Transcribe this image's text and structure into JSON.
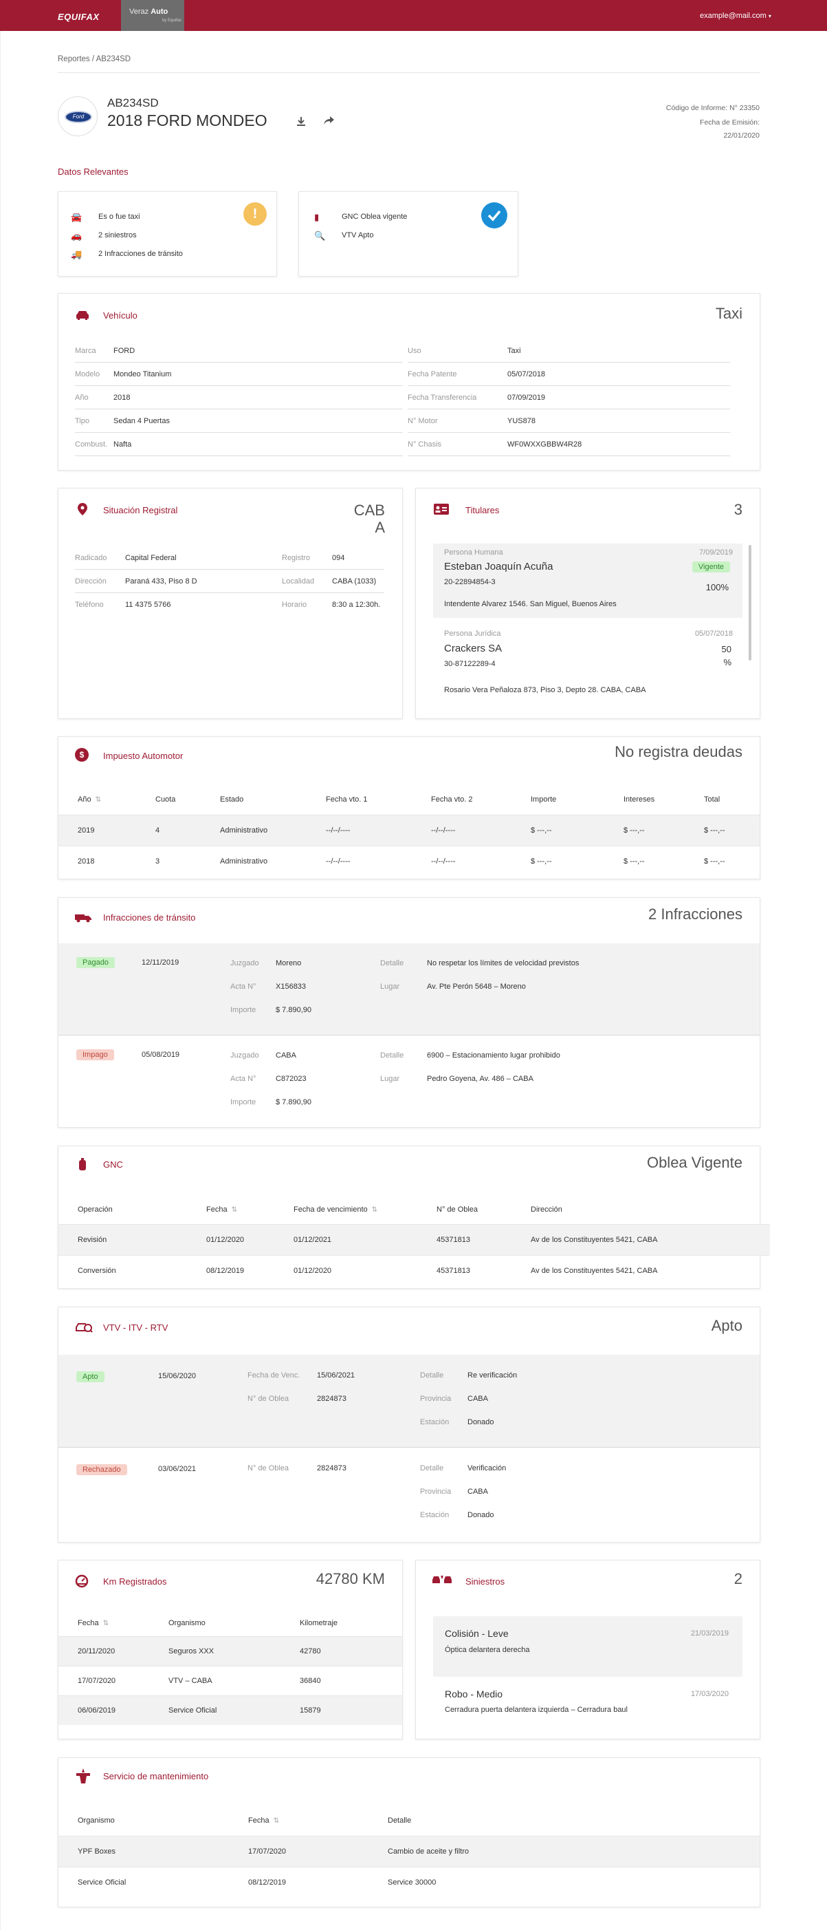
{
  "header": {
    "logo": "EQUIFAX",
    "app_name_1": "Veraz",
    "app_name_2": "Auto",
    "app_sub": "by Equifax",
    "user_email": "example@mail.com"
  },
  "breadcrumb": "Reportes / AB234SD",
  "vehicle_head": {
    "plate": "AB234SD",
    "title": "2018 FORD MONDEO",
    "brand_logo": "Ford",
    "code": "Código de Informe: N° 23350",
    "emission_label": "Fecha de Emisión:",
    "emission_date": "22/01/2020"
  },
  "relevant": {
    "title": "Datos Relevantes",
    "left": [
      "Es o fue taxi",
      "2 siniestros",
      "2 Infracciones de tránsito"
    ],
    "right": [
      "GNC Oblea vigente",
      "VTV Apto"
    ],
    "warning_icon": "exclamation-icon",
    "ok_icon": "check-icon"
  },
  "vehiculo": {
    "title": "Vehículo",
    "status": "Taxi",
    "left": [
      [
        "Marca",
        "FORD"
      ],
      [
        "Modelo",
        "Mondeo Titanium"
      ],
      [
        "Año",
        "2018"
      ],
      [
        "Tipo",
        "Sedan 4 Puertas"
      ],
      [
        "Combust.",
        "Nafta"
      ]
    ],
    "right": [
      [
        "Uso",
        "Taxi"
      ],
      [
        "Fecha Patente",
        "05/07/2018"
      ],
      [
        "Fecha Transferencia",
        "07/09/2019"
      ],
      [
        "N° Motor",
        "YUS878"
      ],
      [
        "N° Chasis",
        "WF0WXXGBBW4R28"
      ]
    ]
  },
  "registral": {
    "title": "Situación Registral",
    "status_1": "CAB",
    "status_2": "A",
    "rows": [
      [
        "Radicado",
        "Capital Federal",
        "Registro",
        "094"
      ],
      [
        "Dirección",
        "Paraná 433, Piso 8 D",
        "Localidad",
        "CABA (1033)"
      ],
      [
        "Teléfono",
        "11 4375 5766",
        "Horario",
        "8:30 a 12:30h."
      ]
    ]
  },
  "titulares": {
    "title": "Titulares",
    "count": "3",
    "items": [
      {
        "type": "Persona Humana",
        "date": "7/09/2019",
        "name": "Esteban Joaquín Acuña",
        "badge": "Vigente",
        "id": "20-22894854-3",
        "pct": "100%",
        "address": "Intendente Alvarez 1546. San Miguel, Buenos Aires"
      },
      {
        "type": "Persona Jurídica",
        "date": "05/07/2018",
        "name": "Crackers SA",
        "pct_1": "50",
        "pct_2": "%",
        "id": "30-87122289-4",
        "address": "Rosario Vera Peñaloza 873, Piso 3, Depto 28. CABA, CABA"
      }
    ]
  },
  "impuesto": {
    "title": "Impuesto Automotor",
    "status": "No registra deudas",
    "headers": [
      "Año",
      "Cuota",
      "Estado",
      "Fecha vto. 1",
      "Fecha vto. 2",
      "Importe",
      "Intereses",
      "Total"
    ],
    "rows": [
      [
        "2019",
        "4",
        "Administrativo",
        "--/--/----",
        "--/--/----",
        "$ ---,--",
        "$ ---,--",
        "$ ---,--"
      ],
      [
        "2018",
        "3",
        "Administrativo",
        "--/--/----",
        "--/--/----",
        "$ ---,--",
        "$ ---,--",
        "$ ---,--"
      ]
    ]
  },
  "infracciones": {
    "title": "Infracciones de tránsito",
    "status": "2 Infracciones",
    "items": [
      {
        "badge": "Pagado",
        "date": "12/11/2019",
        "juzgado_l": "Juzgado",
        "juzgado": "Moreno",
        "acta_l": "Acta N°",
        "acta": "X156833",
        "importe_l": "Importe",
        "importe": "$ 7.890,90",
        "detalle_l": "Detalle",
        "detalle": "No respetar los límites de velocidad previstos",
        "lugar_l": "Lugar",
        "lugar": "Av. Pte Perón 5648 – Moreno"
      },
      {
        "badge": "Impago",
        "date": "05/08/2019",
        "juzgado_l": "Juzgado",
        "juzgado": "CABA",
        "acta_l": "Acta N°",
        "acta": "C872023",
        "importe_l": "Importe",
        "importe": "$ 7.890,90",
        "detalle_l": "Detalle",
        "detalle": "6900 – Estacionamiento lugar prohibido",
        "lugar_l": "Lugar",
        "lugar": "Pedro Goyena, Av.  486 – CABA"
      }
    ]
  },
  "gnc": {
    "title": "GNC",
    "status": "Oblea Vigente",
    "headers": [
      "Operación",
      "Fecha",
      "Fecha de vencimiento",
      "N° de Oblea",
      "Dirección"
    ],
    "rows": [
      [
        "Revisión",
        "01/12/2020",
        "01/12/2021",
        "45371813",
        "Av de los Constituyentes 5421, CABA"
      ],
      [
        "Conversión",
        "08/12/2019",
        "01/12/2020",
        "45371813",
        "Av de los Constituyentes 5421, CABA"
      ]
    ]
  },
  "vtv": {
    "title": "VTV - ITV - RTV",
    "status": "Apto",
    "items": [
      {
        "badge": "Apto",
        "date": "15/06/2020",
        "venc_l": "Fecha de Venc.",
        "venc": "15/06/2021",
        "oblea_l": "N° de Oblea",
        "oblea": "2824873",
        "detalle_l": "Detalle",
        "detalle": "Re verificación",
        "prov_l": "Provincia",
        "prov": "CABA",
        "est_l": "Estación",
        "est": "Donado"
      },
      {
        "badge": "Rechazado",
        "date": "03/06/2021",
        "oblea_l": "N° de Oblea",
        "oblea": "2824873",
        "detalle_l": "Detalle",
        "detalle": "Verificación",
        "prov_l": "Provincia",
        "prov": "CABA",
        "est_l": "Estación",
        "est": "Donado"
      }
    ]
  },
  "km": {
    "title": "Km Registrados",
    "status": "42780 KM",
    "headers": [
      "Fecha",
      "Organismo",
      "Kilometraje"
    ],
    "rows": [
      [
        "20/11/2020",
        "Seguros XXX",
        "42780"
      ],
      [
        "17/07/2020",
        "VTV – CABA",
        "36840"
      ],
      [
        "06/06/2019",
        "Service Oficial",
        "15879"
      ]
    ]
  },
  "siniestros": {
    "title": "Siniestros",
    "count": "2",
    "items": [
      {
        "title": "Colisión - Leve",
        "date": "21/03/2019",
        "desc": "Óptica delantera derecha"
      },
      {
        "title": "Robo - Medio",
        "date": "17/03/2020",
        "desc": "Cerradura puerta delantera izquierda – Cerradura baul"
      }
    ]
  },
  "servicio": {
    "title": "Servicio de mantenimiento",
    "headers": [
      "Organismo",
      "Fecha",
      "Detalle"
    ],
    "rows": [
      [
        "YPF Boxes",
        "17/07/2020",
        "Cambio de aceite y filtro"
      ],
      [
        "Service Oficial",
        "08/12/2019",
        "Service 30000"
      ]
    ]
  },
  "colors": {
    "brand": "#9e1b32",
    "warning": "#f5c15d",
    "ok": "#1a8fd6",
    "green_badge": "#c8f2c4",
    "red_badge": "#f7d0c8"
  }
}
